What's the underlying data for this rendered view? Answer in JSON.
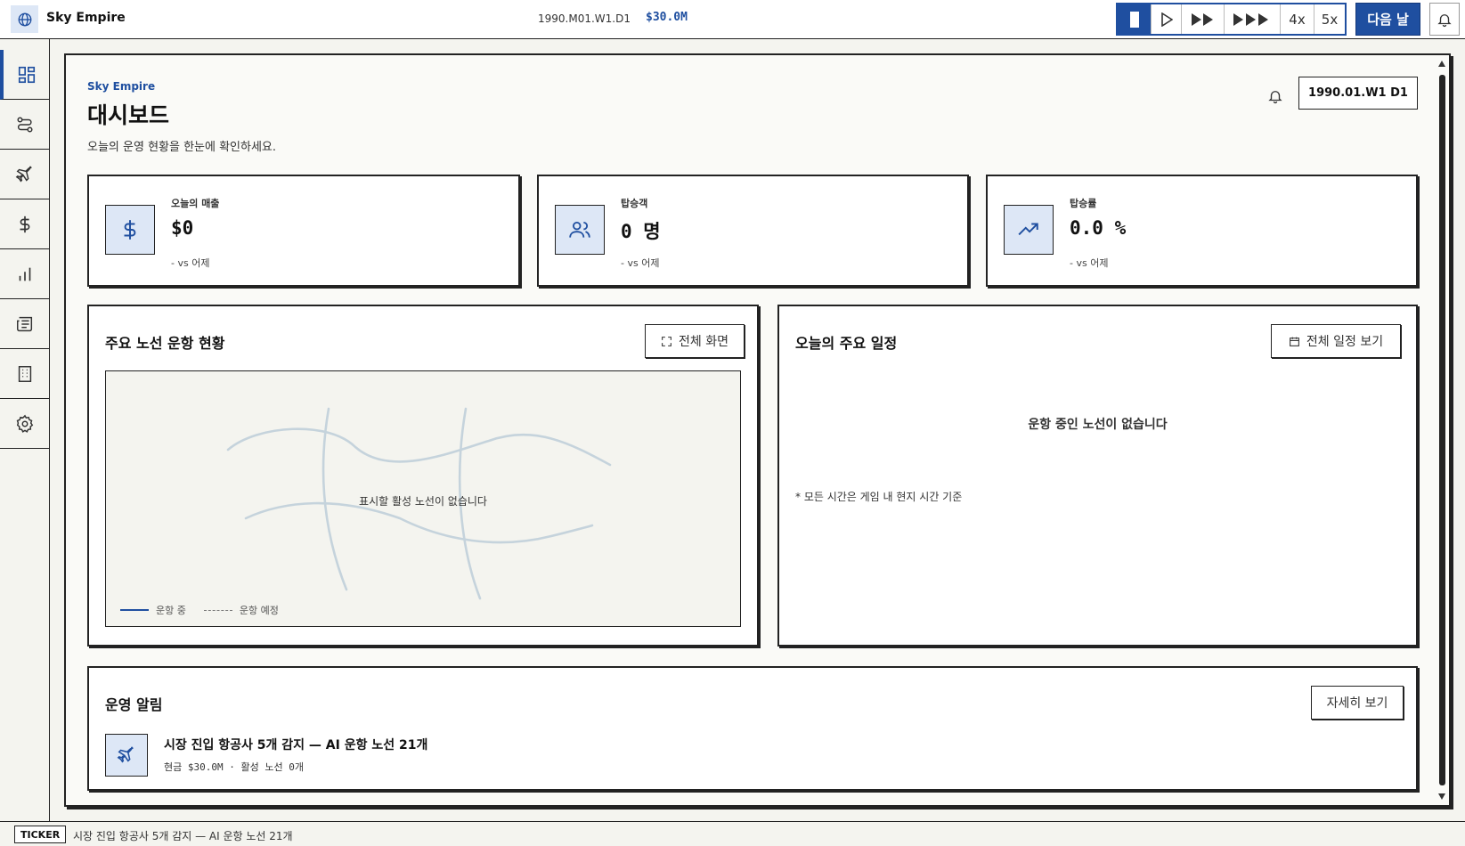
{
  "app": {
    "title": "Sky Empire",
    "game_date": "1990.M01.W1.D1",
    "cash": "$30.0M",
    "speed_labels": [
      "4x",
      "5x"
    ],
    "next_day_label": "다음 날"
  },
  "sidebar": {
    "items": [
      {
        "icon": "dashboard-icon",
        "active": true
      },
      {
        "icon": "routes-icon",
        "active": false
      },
      {
        "icon": "airplane-icon",
        "active": false
      },
      {
        "icon": "dollar-icon",
        "active": false
      },
      {
        "icon": "bar-chart-icon",
        "active": false
      },
      {
        "icon": "newspaper-icon",
        "active": false
      },
      {
        "icon": "building-icon",
        "active": false
      },
      {
        "icon": "gear-icon",
        "active": false
      }
    ]
  },
  "header": {
    "brand": "Sky Empire",
    "title": "대시보드",
    "subtitle": "오늘의 운영 현황을 한눈에 확인하세요.",
    "date_badge": "1990.01.W1 D1"
  },
  "stats": [
    {
      "label": "오늘의 매출",
      "value": "$0",
      "delta": "- vs 어제"
    },
    {
      "label": "탑승객",
      "value": "0 명",
      "delta": "- vs 어제"
    },
    {
      "label": "탑승률",
      "value": "0.0 %",
      "delta": "- vs 어제"
    }
  ],
  "routes_panel": {
    "title": "주요 노선 운항 현황",
    "fullscreen_label": "전체 화면",
    "empty_text": "표시할 활성 노선이 없습니다",
    "legend_active": "운항 중",
    "legend_planned": "운항 예정"
  },
  "schedule_panel": {
    "title": "오늘의 주요 일정",
    "view_all_label": "전체 일정 보기",
    "empty_text": "운항 중인 노선이 없습니다",
    "note": "* 모든 시간은 게임 내 현지 시간 기준"
  },
  "alerts_panel": {
    "title": "운영 알림",
    "details_label": "자세히 보기",
    "headline": "시장 진입 항공사 5개 감지 — AI 운항 노선 21개",
    "detail": "현금 $30.0M · 활성 노선 0개"
  },
  "ticker": {
    "tag": "TICKER",
    "text": "시장 진입 항공사 5개 감지 — AI 운항 노선 21개"
  },
  "colors": {
    "accent": "#1f4fa0",
    "icon_bg": "#dde7f6",
    "map_line": "#c5d3dc"
  }
}
